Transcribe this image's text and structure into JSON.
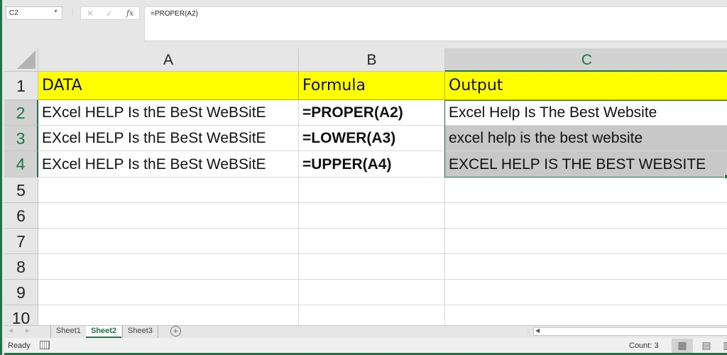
{
  "formula_bar": {
    "name_box": "C2",
    "cancel_icon": "✕",
    "enter_icon": "✓",
    "fx_label": "fx",
    "formula": "=PROPER(A2)"
  },
  "columns": [
    "A",
    "B",
    "C"
  ],
  "selected_column": "C",
  "rows": [
    "1",
    "2",
    "3",
    "4",
    "5",
    "6",
    "7",
    "8",
    "9",
    "10"
  ],
  "selected_rows": [
    "2",
    "3",
    "4"
  ],
  "cells": {
    "r1": [
      "DATA",
      "Formula",
      "Output"
    ],
    "r2": [
      "EXcel HELP Is thE BeSt WeBSitE",
      "=PROPER(A2)",
      "Excel Help Is The Best Website"
    ],
    "r3": [
      "EXcel HELP Is thE BeSt WeBSitE",
      "=LOWER(A3)",
      "excel help is the best website"
    ],
    "r4": [
      "EXcel HELP Is thE BeSt WeBSitE",
      "=UPPER(A4)",
      "EXCEL HELP IS THE BEST WEBSITE"
    ]
  },
  "colors": {
    "accent": "#217346",
    "header_fill": "#ffff00",
    "selection_fill": "#c8c8c8"
  },
  "sheet_tabs": {
    "tabs": [
      "Sheet1",
      "Sheet2",
      "Sheet3"
    ],
    "active": "Sheet2",
    "add_label": "+"
  },
  "status_bar": {
    "mode": "Ready",
    "count": "Count: 3",
    "views": [
      "normal-view",
      "page-layout-view",
      "page-break-view"
    ]
  }
}
